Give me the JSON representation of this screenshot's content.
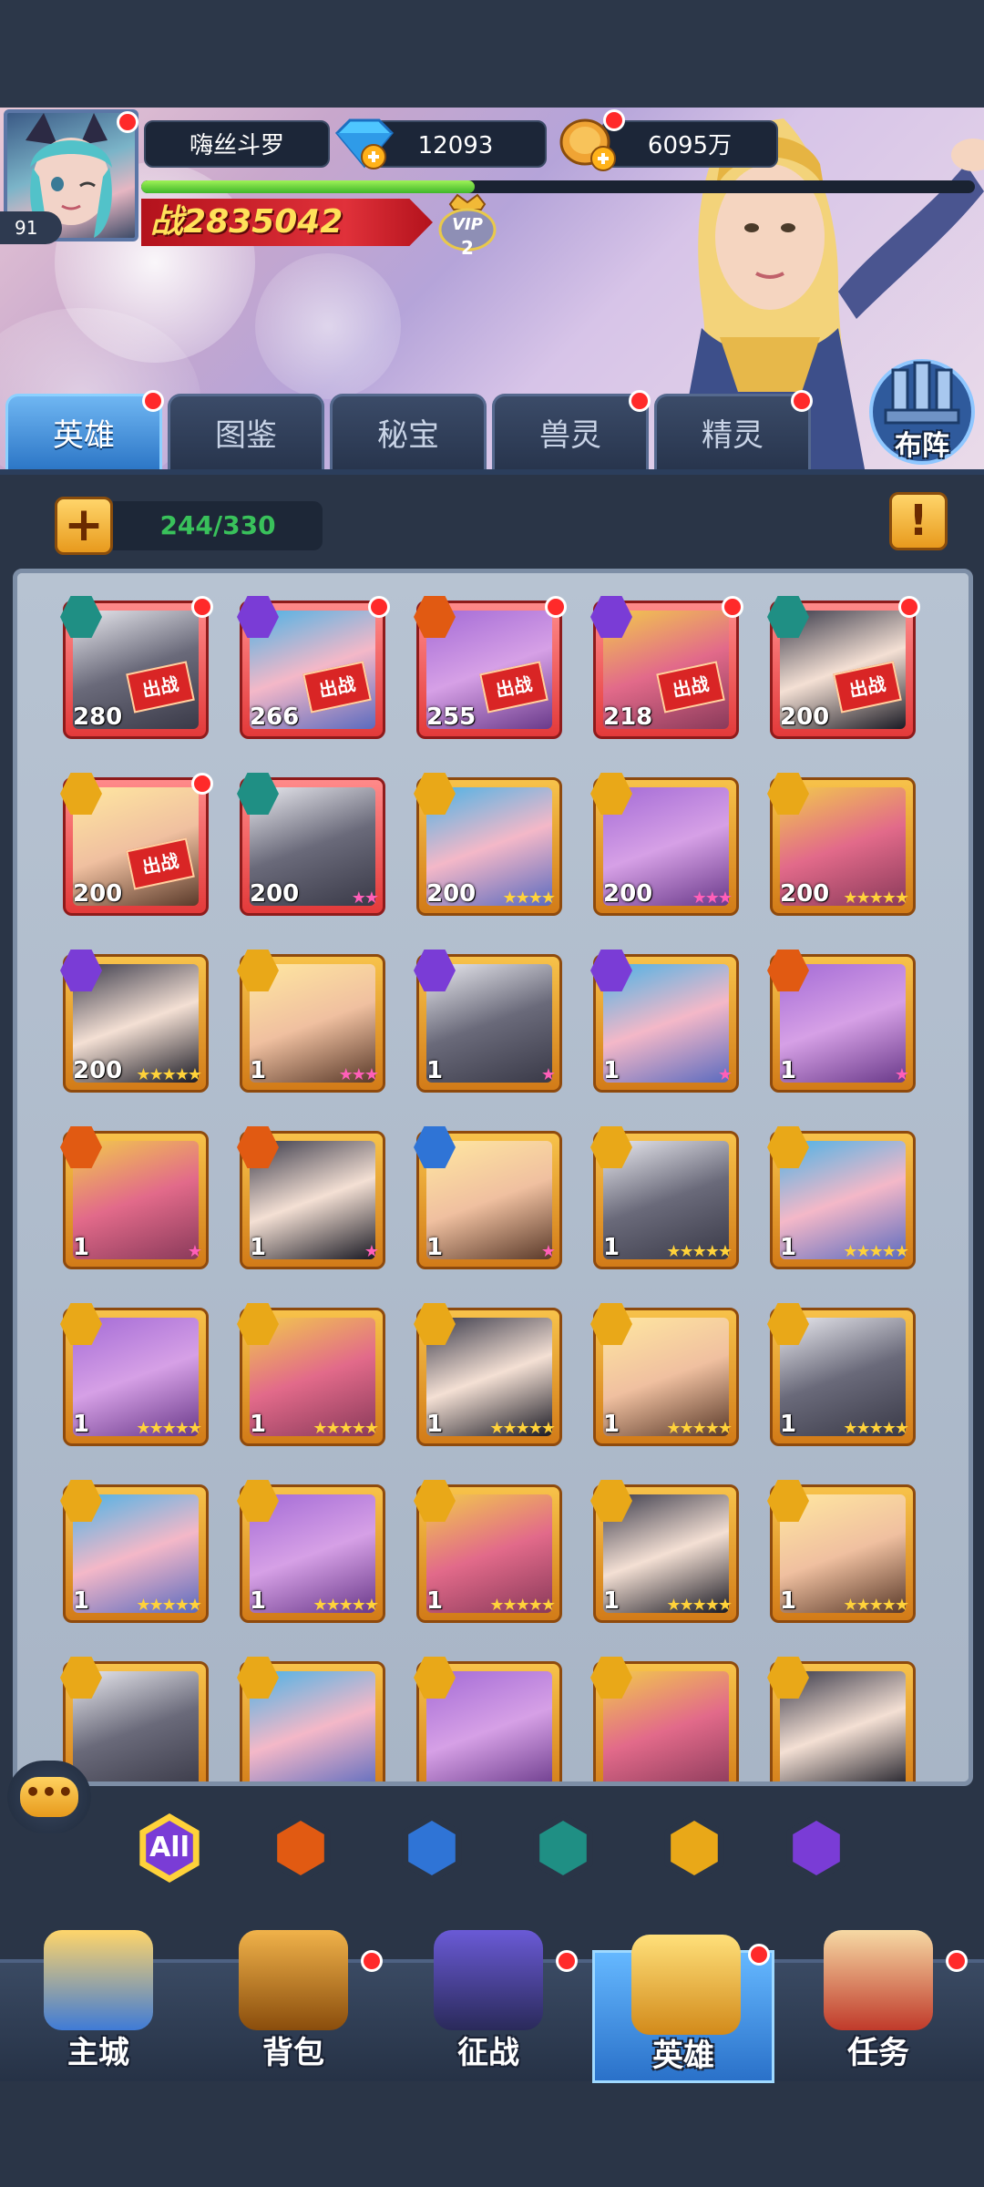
{
  "player": {
    "name": "嗨丝斗罗",
    "level": "91",
    "diamonds": "12093",
    "gold": "6095万",
    "power_label": "战",
    "power": "2835042",
    "vip": "VIP",
    "vip_level": "2",
    "exp_progress": 0.4
  },
  "formation_label": "布阵",
  "tabs": [
    {
      "label": "英雄",
      "active": true,
      "dot": true
    },
    {
      "label": "图鉴",
      "active": false,
      "dot": false
    },
    {
      "label": "秘宝",
      "active": false,
      "dot": false
    },
    {
      "label": "兽灵",
      "active": false,
      "dot": true
    },
    {
      "label": "精灵",
      "active": false,
      "dot": true
    }
  ],
  "hero_count": "244/330",
  "deploy_badge": "出战",
  "heroes": [
    {
      "level": "280",
      "faction": "dark",
      "frame": "red",
      "stars": "",
      "deployed": true,
      "dot": true
    },
    {
      "level": "266",
      "faction": "purple",
      "frame": "red",
      "stars": "",
      "deployed": true,
      "dot": true
    },
    {
      "level": "255",
      "faction": "fire",
      "frame": "red",
      "stars": "",
      "deployed": true,
      "dot": true
    },
    {
      "level": "218",
      "faction": "purple",
      "frame": "red",
      "stars": "",
      "deployed": true,
      "dot": true
    },
    {
      "level": "200",
      "faction": "dark",
      "frame": "red",
      "stars": "",
      "deployed": true,
      "dot": true
    },
    {
      "level": "200",
      "faction": "gold",
      "frame": "red",
      "stars": "",
      "deployed": true,
      "dot": true
    },
    {
      "level": "200",
      "faction": "dark",
      "frame": "red",
      "stars": "★★",
      "deployed": false,
      "dot": false
    },
    {
      "level": "200",
      "faction": "gold",
      "frame": "gold",
      "stars": "★★★★",
      "deployed": false,
      "dot": false
    },
    {
      "level": "200",
      "faction": "gold",
      "frame": "gold",
      "stars": "★★★",
      "deployed": false,
      "dot": false
    },
    {
      "level": "200",
      "faction": "gold",
      "frame": "gold",
      "stars": "★★★★★",
      "deployed": false,
      "dot": false
    },
    {
      "level": "200",
      "faction": "purple",
      "frame": "gold",
      "stars": "★★★★★",
      "deployed": false,
      "dot": false
    },
    {
      "level": "1",
      "faction": "gold",
      "frame": "gold",
      "stars": "★★★",
      "deployed": false,
      "dot": false
    },
    {
      "level": "1",
      "faction": "purple",
      "frame": "gold",
      "stars": "★",
      "deployed": false,
      "dot": false
    },
    {
      "level": "1",
      "faction": "purple",
      "frame": "gold",
      "stars": "★",
      "deployed": false,
      "dot": false
    },
    {
      "level": "1",
      "faction": "fire",
      "frame": "gold",
      "stars": "★",
      "deployed": false,
      "dot": false
    },
    {
      "level": "1",
      "faction": "fire",
      "frame": "gold",
      "stars": "★",
      "deployed": false,
      "dot": false
    },
    {
      "level": "1",
      "faction": "fire",
      "frame": "gold",
      "stars": "★",
      "deployed": false,
      "dot": false
    },
    {
      "level": "1",
      "faction": "blue",
      "frame": "gold",
      "stars": "★",
      "deployed": false,
      "dot": false
    },
    {
      "level": "1",
      "faction": "gold",
      "frame": "gold",
      "stars": "★★★★★",
      "deployed": false,
      "dot": false
    },
    {
      "level": "1",
      "faction": "gold",
      "frame": "gold",
      "stars": "★★★★★",
      "deployed": false,
      "dot": false
    },
    {
      "level": "1",
      "faction": "gold",
      "frame": "gold",
      "stars": "★★★★★",
      "deployed": false,
      "dot": false
    },
    {
      "level": "1",
      "faction": "gold",
      "frame": "gold",
      "stars": "★★★★★",
      "deployed": false,
      "dot": false
    },
    {
      "level": "1",
      "faction": "gold",
      "frame": "gold",
      "stars": "★★★★★",
      "deployed": false,
      "dot": false
    },
    {
      "level": "1",
      "faction": "gold",
      "frame": "gold",
      "stars": "★★★★★",
      "deployed": false,
      "dot": false
    },
    {
      "level": "1",
      "faction": "gold",
      "frame": "gold",
      "stars": "★★★★★",
      "deployed": false,
      "dot": false
    },
    {
      "level": "1",
      "faction": "gold",
      "frame": "gold",
      "stars": "★★★★★",
      "deployed": false,
      "dot": false
    },
    {
      "level": "1",
      "faction": "gold",
      "frame": "gold",
      "stars": "★★★★★",
      "deployed": false,
      "dot": false
    },
    {
      "level": "1",
      "faction": "gold",
      "frame": "gold",
      "stars": "★★★★★",
      "deployed": false,
      "dot": false
    },
    {
      "level": "1",
      "faction": "gold",
      "frame": "gold",
      "stars": "★★★★★",
      "deployed": false,
      "dot": false
    },
    {
      "level": "1",
      "faction": "gold",
      "frame": "gold",
      "stars": "★★★★★",
      "deployed": false,
      "dot": false
    },
    {
      "level": "",
      "faction": "gold",
      "frame": "gold",
      "stars": "",
      "deployed": false,
      "dot": false
    },
    {
      "level": "",
      "faction": "gold",
      "frame": "gold",
      "stars": "",
      "deployed": false,
      "dot": false
    },
    {
      "level": "",
      "faction": "gold",
      "frame": "gold",
      "stars": "",
      "deployed": false,
      "dot": false
    },
    {
      "level": "",
      "faction": "gold",
      "frame": "gold",
      "stars": "",
      "deployed": false,
      "dot": false
    },
    {
      "level": "",
      "faction": "gold",
      "frame": "gold",
      "stars": "",
      "deployed": false,
      "dot": false
    }
  ],
  "faction_filters": [
    {
      "key": "all",
      "label": "All",
      "color": "#7a3cd6"
    },
    {
      "key": "fire",
      "label": "",
      "color": "#e15a12"
    },
    {
      "key": "blue",
      "label": "",
      "color": "#2f74d6"
    },
    {
      "key": "dark",
      "label": "",
      "color": "#1f8f84"
    },
    {
      "key": "gold",
      "label": "",
      "color": "#e9a818"
    },
    {
      "key": "purple",
      "label": "",
      "color": "#7a3cd6"
    }
  ],
  "nav": [
    {
      "label": "主城",
      "icon": "castle-icon",
      "active": false,
      "dot": false
    },
    {
      "label": "背包",
      "icon": "treasure-chest-icon",
      "active": false,
      "dot": true
    },
    {
      "label": "征战",
      "icon": "dragon-portal-icon",
      "active": false,
      "dot": true
    },
    {
      "label": "英雄",
      "icon": "hero-helmet-icon",
      "active": true,
      "dot": true
    },
    {
      "label": "任务",
      "icon": "scroll-icon",
      "active": false,
      "dot": true
    }
  ],
  "colors": {
    "accent": "#2a74c5",
    "danger": "#ff2a2a",
    "gold": "#f7c24a",
    "exp": "#3fb72a",
    "count": "#39c15b"
  }
}
